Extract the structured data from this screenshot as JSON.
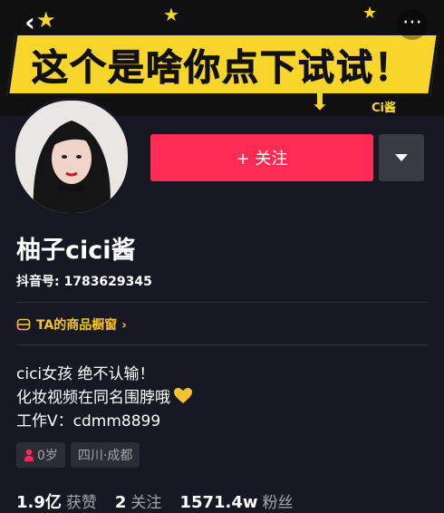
{
  "banner": {
    "headline": "这个是啥你点下试试！",
    "signature": "Ci酱"
  },
  "icons": {
    "back": "chevron-left-icon",
    "more": "more-dots-icon",
    "dropdown": "caret-down-icon",
    "shop": "shop-window-icon",
    "heart": "yellow-heart-icon",
    "gender": "female-icon"
  },
  "actions": {
    "follow_label": "+ 关注"
  },
  "profile": {
    "name": "柚子cici酱",
    "douyin_id": "抖音号: 1783629345",
    "shop_link": "TA的商品橱窗 ›",
    "bio_lines": [
      "cici女孩 绝不认输！",
      "化妆视频在同名围脖哦",
      "工作V：cdmm8899"
    ],
    "tags": [
      "0岁",
      "四川·成都"
    ]
  },
  "stats": {
    "likes_value": "1.9亿",
    "likes_label": "获赞",
    "following_value": "2",
    "following_label": "关注",
    "followers_value": "1571.4w",
    "followers_label": "粉丝"
  },
  "colors": {
    "background": "#161823",
    "follow": "#fe2c55",
    "banner_yellow": "#f8d52a",
    "shop_gold": "#f5c232"
  }
}
